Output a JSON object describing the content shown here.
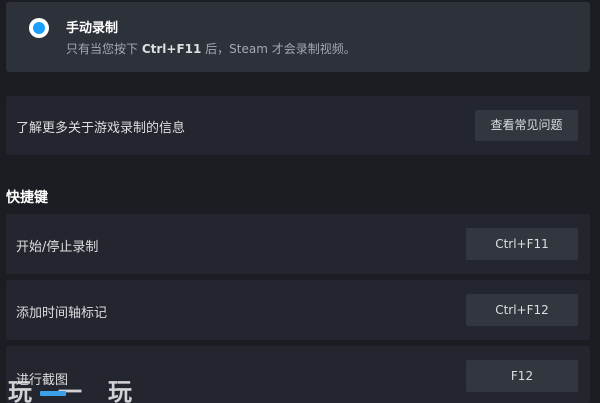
{
  "manual_recording": {
    "title": "手动录制",
    "desc_prefix": "只有当您按下 ",
    "desc_key": "Ctrl+F11",
    "desc_suffix": " 后，Steam 才会录制视频。",
    "selected": true
  },
  "learn_more": {
    "label": "了解更多关于游戏录制的信息",
    "button": "查看常见问题"
  },
  "shortcuts": {
    "header": "快捷键",
    "items": [
      {
        "label": "开始/停止录制",
        "key": "Ctrl+F11"
      },
      {
        "label": "添加时间轴标记",
        "key": "Ctrl+F12"
      },
      {
        "label": "进行截图",
        "key": "F12"
      }
    ]
  },
  "watermark": {
    "text": "玩一玩"
  },
  "colors": {
    "background": "#1b1d23",
    "panel": "#23262e",
    "radio_accent": "#1a9fff",
    "button": "#32363f"
  }
}
